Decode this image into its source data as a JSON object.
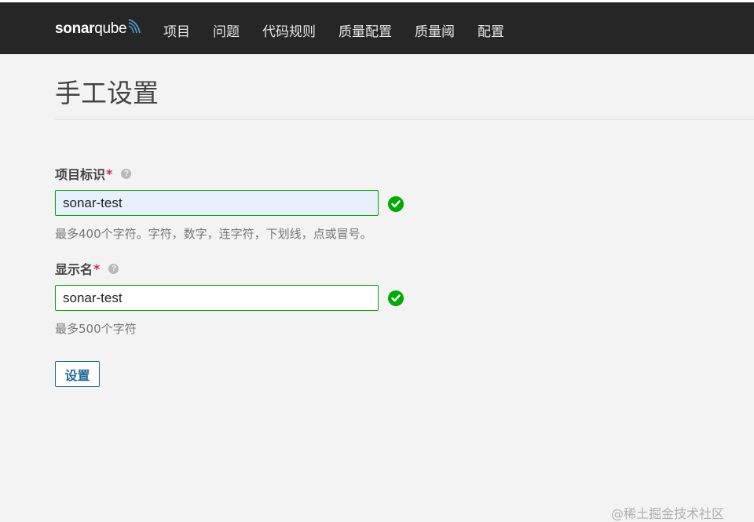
{
  "brand": {
    "name_bold": "sonar",
    "name_light": "qube"
  },
  "nav": {
    "items": [
      "项目",
      "问题",
      "代码规则",
      "质量配置",
      "质量阈",
      "配置"
    ]
  },
  "page": {
    "title": "手工设置"
  },
  "form": {
    "project_key": {
      "label": "项目标识",
      "required_mark": "*",
      "help_glyph": "?",
      "value": "sonar-test",
      "hint": "最多400个字符。字符，数字，连字符，下划线，点或冒号。"
    },
    "display_name": {
      "label": "显示名",
      "required_mark": "*",
      "help_glyph": "?",
      "value": "sonar-test",
      "hint": "最多500个字符"
    },
    "submit_label": "设置"
  },
  "watermark": "@稀土掘金技术社区",
  "colors": {
    "navbar": "#262626",
    "valid": "#00aa00",
    "primary": "#236a97",
    "required": "#d02f3a"
  }
}
